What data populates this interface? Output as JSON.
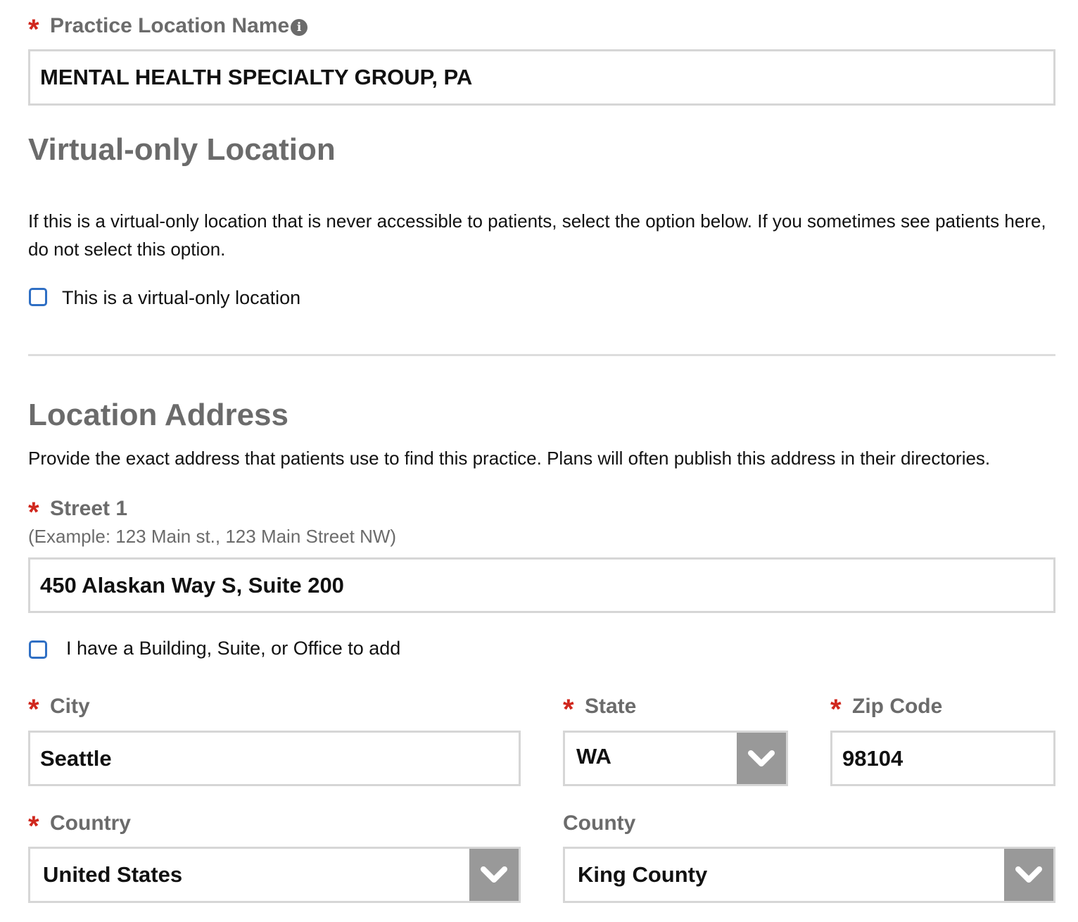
{
  "practice_location": {
    "required_marker": "*",
    "label": "Practice Location Name",
    "info_icon": "info-circle-icon",
    "value": "MENTAL HEALTH SPECIALTY GROUP, PA"
  },
  "virtual_section": {
    "heading": "Virtual-only Location",
    "description": "If this is a virtual-only location that is never accessible to patients, select the option below. If you sometimes see patients here, do not select this option.",
    "checkbox_label": "This is a virtual-only location",
    "checked": false
  },
  "address_section": {
    "heading": "Location Address",
    "description": "Provide the exact address that patients use to find this practice. Plans will often publish this address in their directories.",
    "street1": {
      "required_marker": "*",
      "label": "Street 1",
      "hint": "(Example: 123 Main st., 123 Main Street NW)",
      "value": "450 Alaskan Way S, Suite 200"
    },
    "suite_checkbox": {
      "label": "I have a Building, Suite, or Office to add",
      "checked": false
    },
    "city": {
      "required_marker": "*",
      "label": "City",
      "value": "Seattle"
    },
    "state": {
      "required_marker": "*",
      "label": "State",
      "value": "WA",
      "arrow_icon": "chevron-down-icon"
    },
    "zip": {
      "required_marker": "*",
      "label": "Zip Code",
      "value": "98104"
    },
    "country": {
      "required_marker": "*",
      "label": "Country",
      "value": "United States",
      "arrow_icon": "chevron-down-icon"
    },
    "county": {
      "label": "County",
      "value": "King County",
      "arrow_icon": "chevron-down-icon"
    }
  },
  "colors": {
    "required": "#d0271d",
    "label": "#6b6b6b",
    "input_border": "#d6d6d6",
    "checkbox_border": "#2f6fc4",
    "select_arrow_bg": "#999999"
  }
}
